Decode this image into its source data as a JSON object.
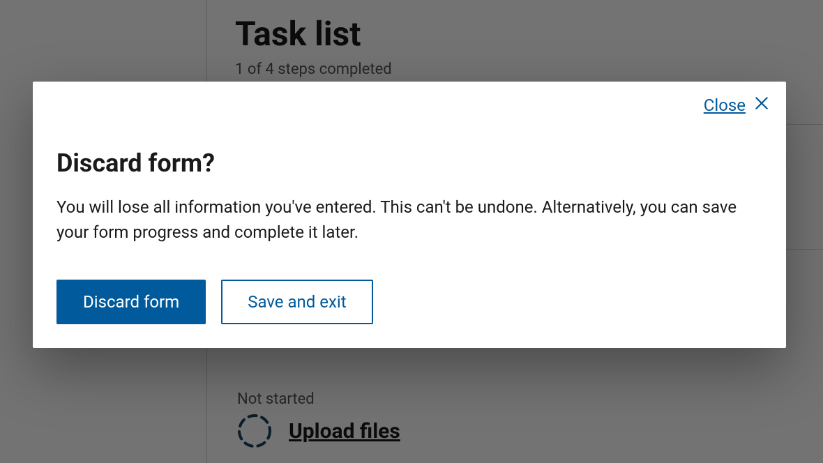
{
  "page": {
    "title": "Task list",
    "progress_text": "1 of 4 steps completed"
  },
  "task_item": {
    "status": "Not started",
    "link_label": "Upload files"
  },
  "modal": {
    "close_label": "Close",
    "title": "Discard form?",
    "body": "You will lose all information you've entered. This can't be undone. Alternatively, you can save your form progress and complete it later.",
    "primary_label": "Discard form",
    "secondary_label": "Save and exit"
  },
  "colors": {
    "accent": "#005a9c"
  }
}
